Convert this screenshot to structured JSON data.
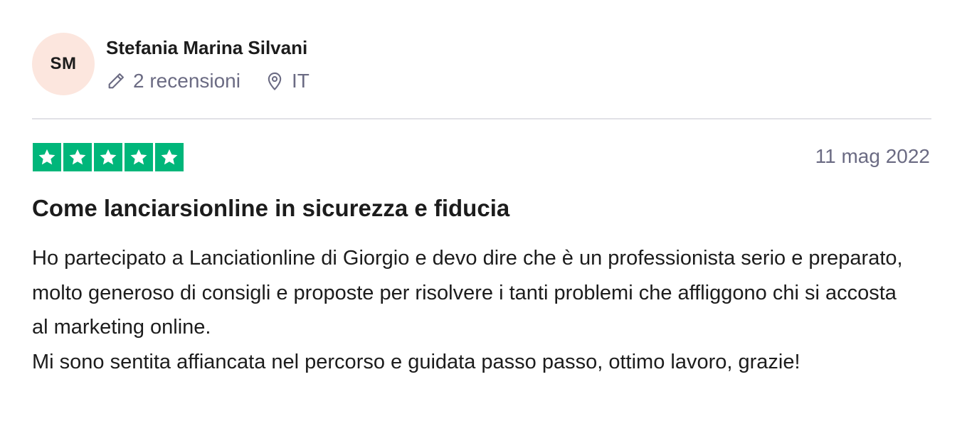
{
  "reviewer": {
    "initials": "SM",
    "name": "Stefania Marina Silvani",
    "reviews_count": "2 recensioni",
    "country": "IT",
    "avatar_color": "#fce6de"
  },
  "review": {
    "rating": 5,
    "rating_max": 5,
    "star_color": "#00b67a",
    "date": "11 mag 2022",
    "title": "Come lanciarsionline in sicurezza e fiducia",
    "paragraphs": [
      "Ho partecipato a Lanciationline di Giorgio e devo dire che è un professionista serio e preparato, molto generoso di consigli e proposte per risolvere i tanti problemi che affliggono chi si accosta al marketing online.",
      "Mi sono sentita affiancata nel percorso e guidata passo passo, ottimo lavoro, grazie!"
    ]
  },
  "icons": {
    "reviews": "pencil-icon",
    "country": "location-pin-icon",
    "star": "star-icon"
  }
}
